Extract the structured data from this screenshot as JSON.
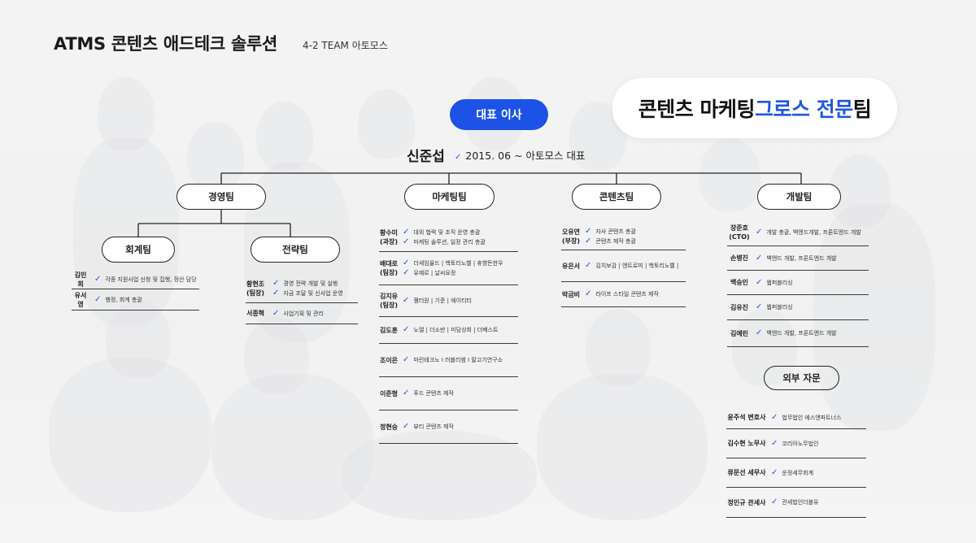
{
  "header": {
    "title": "ATMS 콘텐츠 애드테크 솔루션",
    "subtitle": "4-2 TEAM 아토모스"
  },
  "tagline": {
    "part1": "콘텐츠 마케팅 ",
    "part2": "그로스 전문",
    "part3": "팀"
  },
  "ceo": {
    "button_label": "대표 이사",
    "name": "신준섭",
    "note": "2015. 06 ~ 아토모스 대표"
  },
  "teams": {
    "management": "경영팀",
    "marketing": "마케팅팀",
    "content": "콘텐츠팀",
    "dev": "개발팀",
    "accounting": "회계팀",
    "strategy": "전략팀",
    "advisors": "외부 자문"
  },
  "accounting_members": [
    {
      "name": [
        "김민희"
      ],
      "duties": [
        "각종 지원사업 신청 및 집행, 정산 담당"
      ]
    },
    {
      "name": [
        "유서영"
      ],
      "duties": [
        "행정, 회계 총괄"
      ]
    }
  ],
  "strategy_members": [
    {
      "name": [
        "황현조",
        "(팀장)"
      ],
      "duties": [
        "경영 전략 개발 및 실행",
        "자금 조달 및 신사업 운영"
      ]
    },
    {
      "name": [
        "서종혁"
      ],
      "duties": [
        "사업기획 및 관리"
      ]
    }
  ],
  "marketing_members": [
    {
      "name": [
        "황수미",
        "(과장)"
      ],
      "duties": [
        "대외 협력 및 조직 운영 총괄",
        "마케팅 솔루션, 일정 관리 총괄"
      ]
    },
    {
      "name": [
        "배대로",
        "(팀장)"
      ],
      "duties": [
        "더세임올드 | 핵토리노벨 | 휴향돈한우",
        "유예르 | 날씨요정"
      ]
    },
    {
      "name": [
        "김지유",
        "(팀장)"
      ],
      "duties": [
        "젬터원 | 기준 | 에이티티"
      ]
    },
    {
      "name": [
        "김도훈"
      ],
      "duties": [
        "노엘 | 더소반 | 미담상회 | 더베스트"
      ]
    },
    {
      "name": [
        "조이은"
      ],
      "duties": [
        "마린테크노 I 러블리썸 I 말고기연구소"
      ]
    },
    {
      "name": [
        "이준형"
      ],
      "duties": [
        "푸드 콘텐츠 제작"
      ]
    },
    {
      "name": [
        "정현승"
      ],
      "duties": [
        "뷰티 콘텐츠 제작"
      ]
    }
  ],
  "content_members": [
    {
      "name": [
        "오유연",
        "(부장)"
      ],
      "duties": [
        "자사 콘텐츠 총괄",
        "콘텐츠 제작 총괄"
      ]
    },
    {
      "name": [
        "유은서"
      ],
      "duties": [
        "김치보감 | 엔트로피 | 핵토리노벨 |"
      ]
    },
    {
      "name": [
        "박금비"
      ],
      "duties": [
        "라이프 스타일 콘텐츠 제작"
      ]
    }
  ],
  "dev_members": [
    {
      "name": [
        "장준호",
        "(CTO)"
      ],
      "duties": [
        "개발 총괄, 백엔드개발, 프론트엔드 개발"
      ]
    },
    {
      "name": [
        "손병진"
      ],
      "duties": [
        "백엔드 개발, 프론트엔드 개발"
      ]
    },
    {
      "name": [
        "백승인"
      ],
      "duties": [
        "웹퍼블리싱"
      ]
    },
    {
      "name": [
        "김유진"
      ],
      "duties": [
        "웹퍼블리싱"
      ]
    },
    {
      "name": [
        "김예린"
      ],
      "duties": [
        "백엔드 개발, 프론트엔드 개발"
      ]
    }
  ],
  "advisor_members": [
    {
      "name": [
        "윤주석 변호사"
      ],
      "duties": [
        "법무법인 에스앤파트너스"
      ]
    },
    {
      "name": [
        "김수현 노무사"
      ],
      "duties": [
        "코리아노무법인"
      ]
    },
    {
      "name": [
        "류문선 세무사"
      ],
      "duties": [
        "운정세무회계"
      ]
    },
    {
      "name": [
        "정민규 관세사"
      ],
      "duties": [
        "관세법인더블유"
      ]
    }
  ],
  "colors": {
    "accent": "#1f56e0",
    "ceo_button": "#1c53e6",
    "line": "#222222"
  }
}
